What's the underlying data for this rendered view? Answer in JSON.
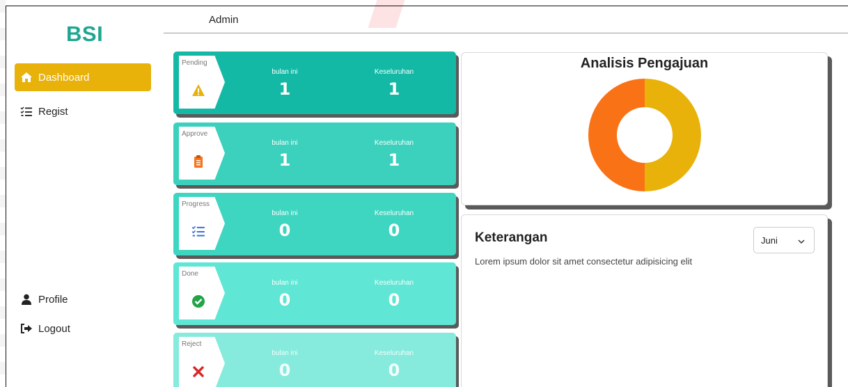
{
  "brand": "BSI",
  "header": {
    "title": "Admin"
  },
  "sidebar": {
    "items": [
      {
        "label": "Dashboard",
        "icon": "home-icon",
        "active": true
      },
      {
        "label": "Regist",
        "icon": "list-check-icon"
      },
      {
        "label": "Profile",
        "icon": "user-icon"
      },
      {
        "label": "Logout",
        "icon": "sign-out-icon"
      }
    ]
  },
  "cards": [
    {
      "status": "Pending",
      "icon": "warning-icon",
      "month_label": "bulan ini",
      "month_value": "1",
      "total_label": "Keseluruhan",
      "total_value": "1"
    },
    {
      "status": "Approve",
      "icon": "clipboard-icon",
      "month_label": "bulan ini",
      "month_value": "1",
      "total_label": "Keseluruhan",
      "total_value": "1"
    },
    {
      "status": "Progress",
      "icon": "list-check-icon",
      "month_label": "bulan ini",
      "month_value": "0",
      "total_label": "Keseluruhan",
      "total_value": "0"
    },
    {
      "status": "Done",
      "icon": "check-circle-icon",
      "month_label": "bulan ini",
      "month_value": "0",
      "total_label": "Keseluruhan",
      "total_value": "0"
    },
    {
      "status": "Reject",
      "icon": "x-mark-icon",
      "month_label": "bulan ini",
      "month_value": "0",
      "total_label": "Keseluruhan",
      "total_value": "0"
    }
  ],
  "chart": {
    "title": "Analisis Pengajuan"
  },
  "chart_data": {
    "type": "pie",
    "donut": true,
    "title": "Analisis Pengajuan",
    "slices": [
      {
        "value": 1,
        "color": "#e8b20b"
      },
      {
        "value": 1,
        "color": "#f97316"
      }
    ]
  },
  "info": {
    "title": "Keterangan",
    "text": "Lorem ipsum dolor sit amet consectetur adipisicing elit",
    "month_select": "Juni"
  },
  "colors": {
    "brand": "#1ea690",
    "active_nav": "#e8b20b",
    "pending": "#14b9a6",
    "approve": "#3bd1bd",
    "progress": "#3ed6c1",
    "done": "#5fe6d4",
    "reject": "#86eadc"
  }
}
